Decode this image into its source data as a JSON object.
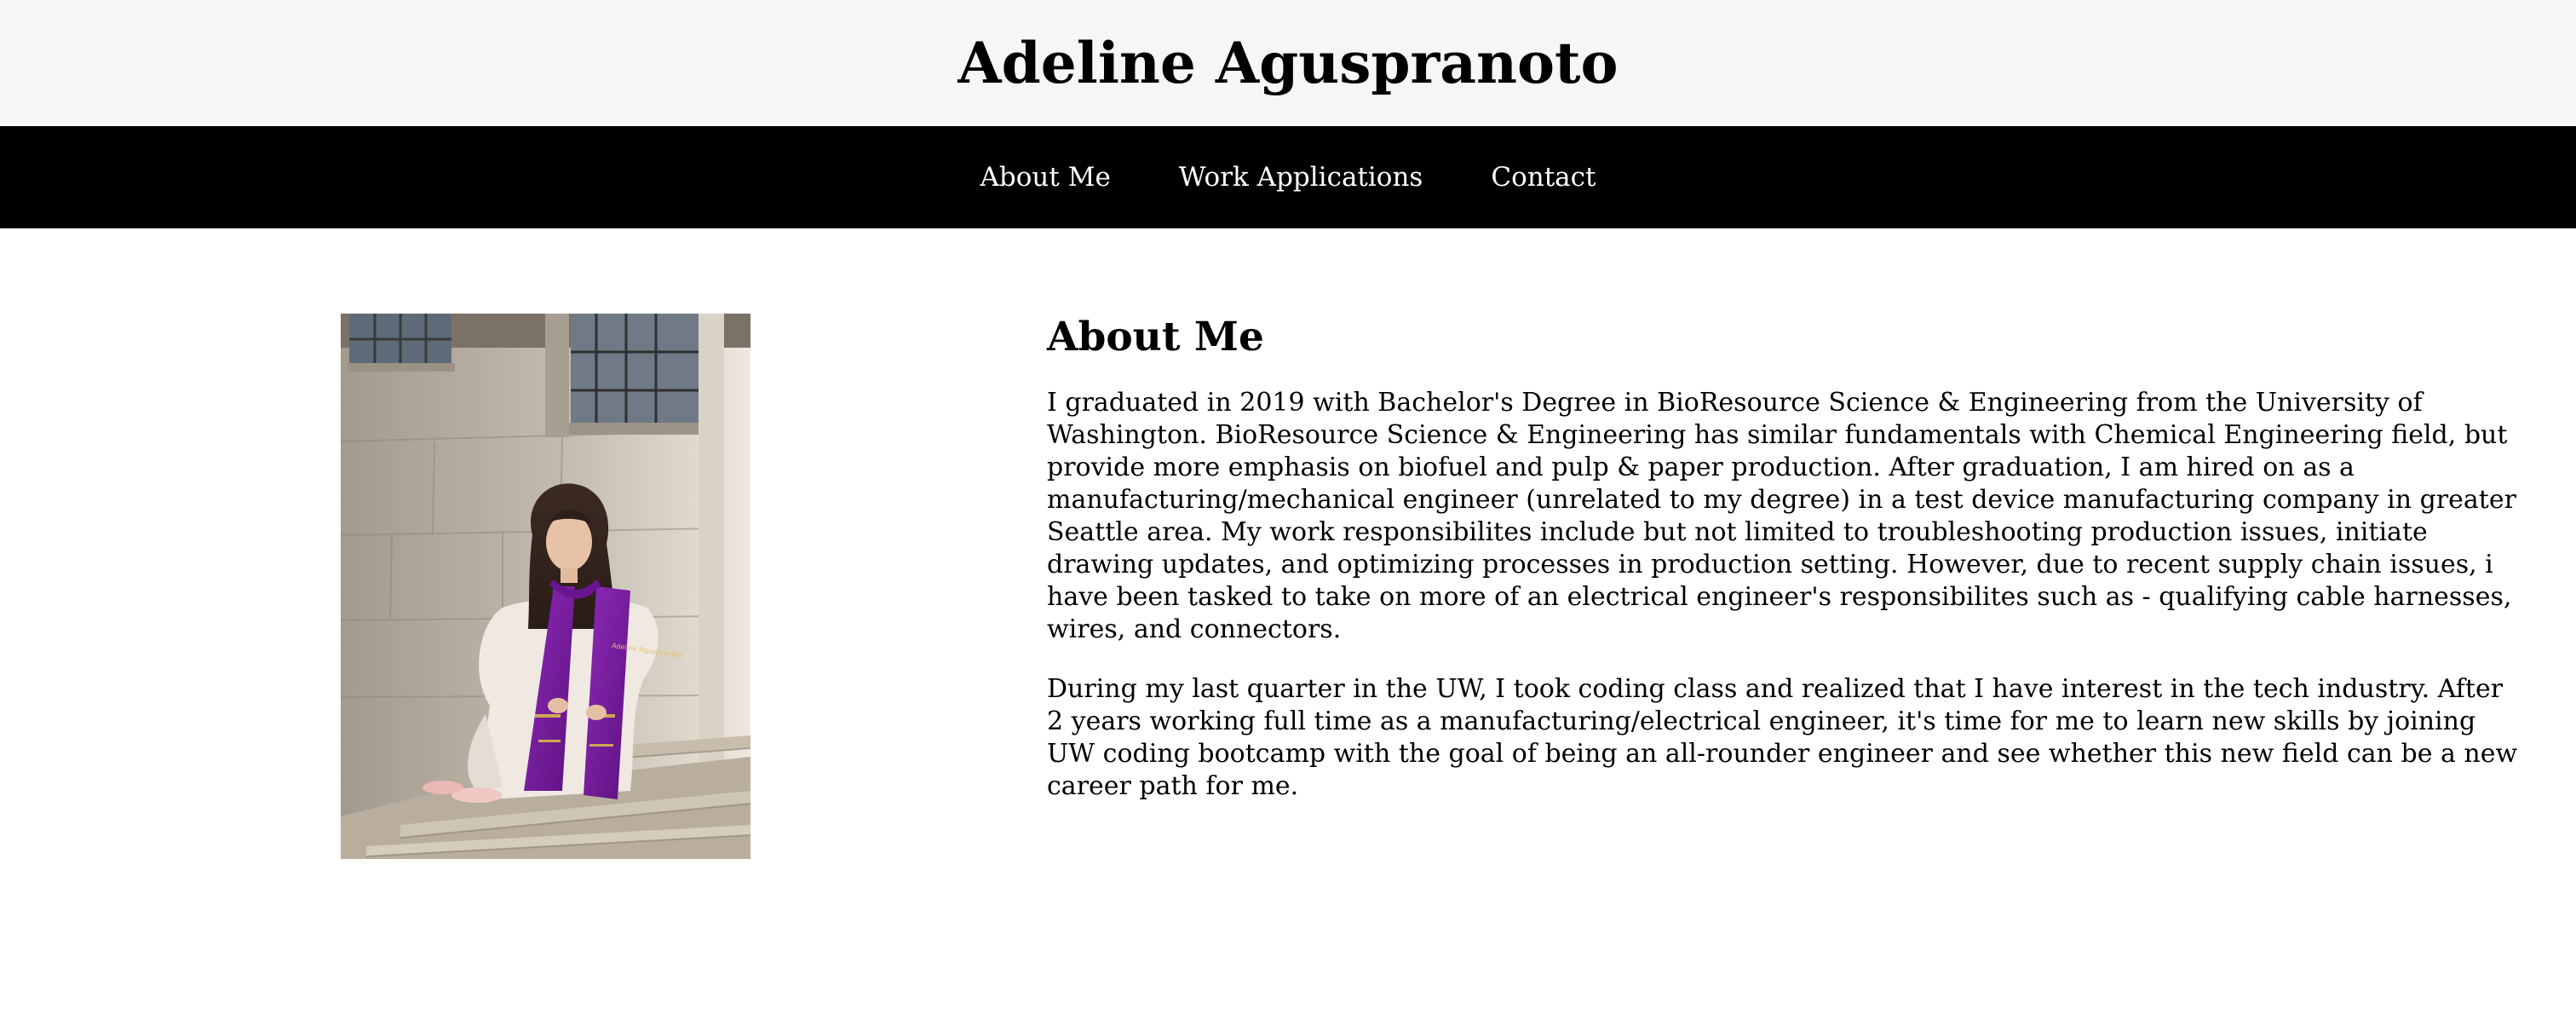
{
  "header": {
    "site_title": "Adeline Aguspranoto"
  },
  "nav": {
    "items": [
      {
        "label": "About Me"
      },
      {
        "label": "Work Applications"
      },
      {
        "label": "Contact"
      }
    ]
  },
  "main": {
    "photo": {
      "stole_text": "Adeline Aguspranoto",
      "colors": {
        "stole": "#7b1fa2",
        "dress": "#efe9e2",
        "stone": "#b7ada0"
      }
    },
    "about": {
      "heading": "About Me",
      "paragraphs": [
        "I graduated in 2019 with Bachelor's Degree in BioResource Science & Engineering from the University of Washington. BioResource Science & Engineering has similar fundamentals with Chemical Engineering field, but provide more emphasis on biofuel and pulp & paper production. After graduation, I am hired on as a manufacturing/mechanical engineer (unrelated to my degree) in a test device manufacturing company in greater Seattle area. My work responsibilites include but not limited to troubleshooting production issues, initiate drawing updates, and optimizing processes in production setting. However, due to recent supply chain issues, i have been tasked to take on more of an electrical engineer's responsibilites such as - qualifying cable harnesses, wires, and connectors.",
        "During my last quarter in the UW, I took coding class and realized that I have interest in the tech industry. After 2 years working full time as a manufacturing/electrical engineer, it's time for me to learn new skills by joining UW coding bootcamp with the goal of being an all-rounder engineer and see whether this new field can be a new career path for me."
      ]
    }
  },
  "colors": {
    "header_bg": "#f6f6f6",
    "nav_bg": "#000000",
    "nav_text": "#ffffff",
    "body_text": "#000000"
  }
}
